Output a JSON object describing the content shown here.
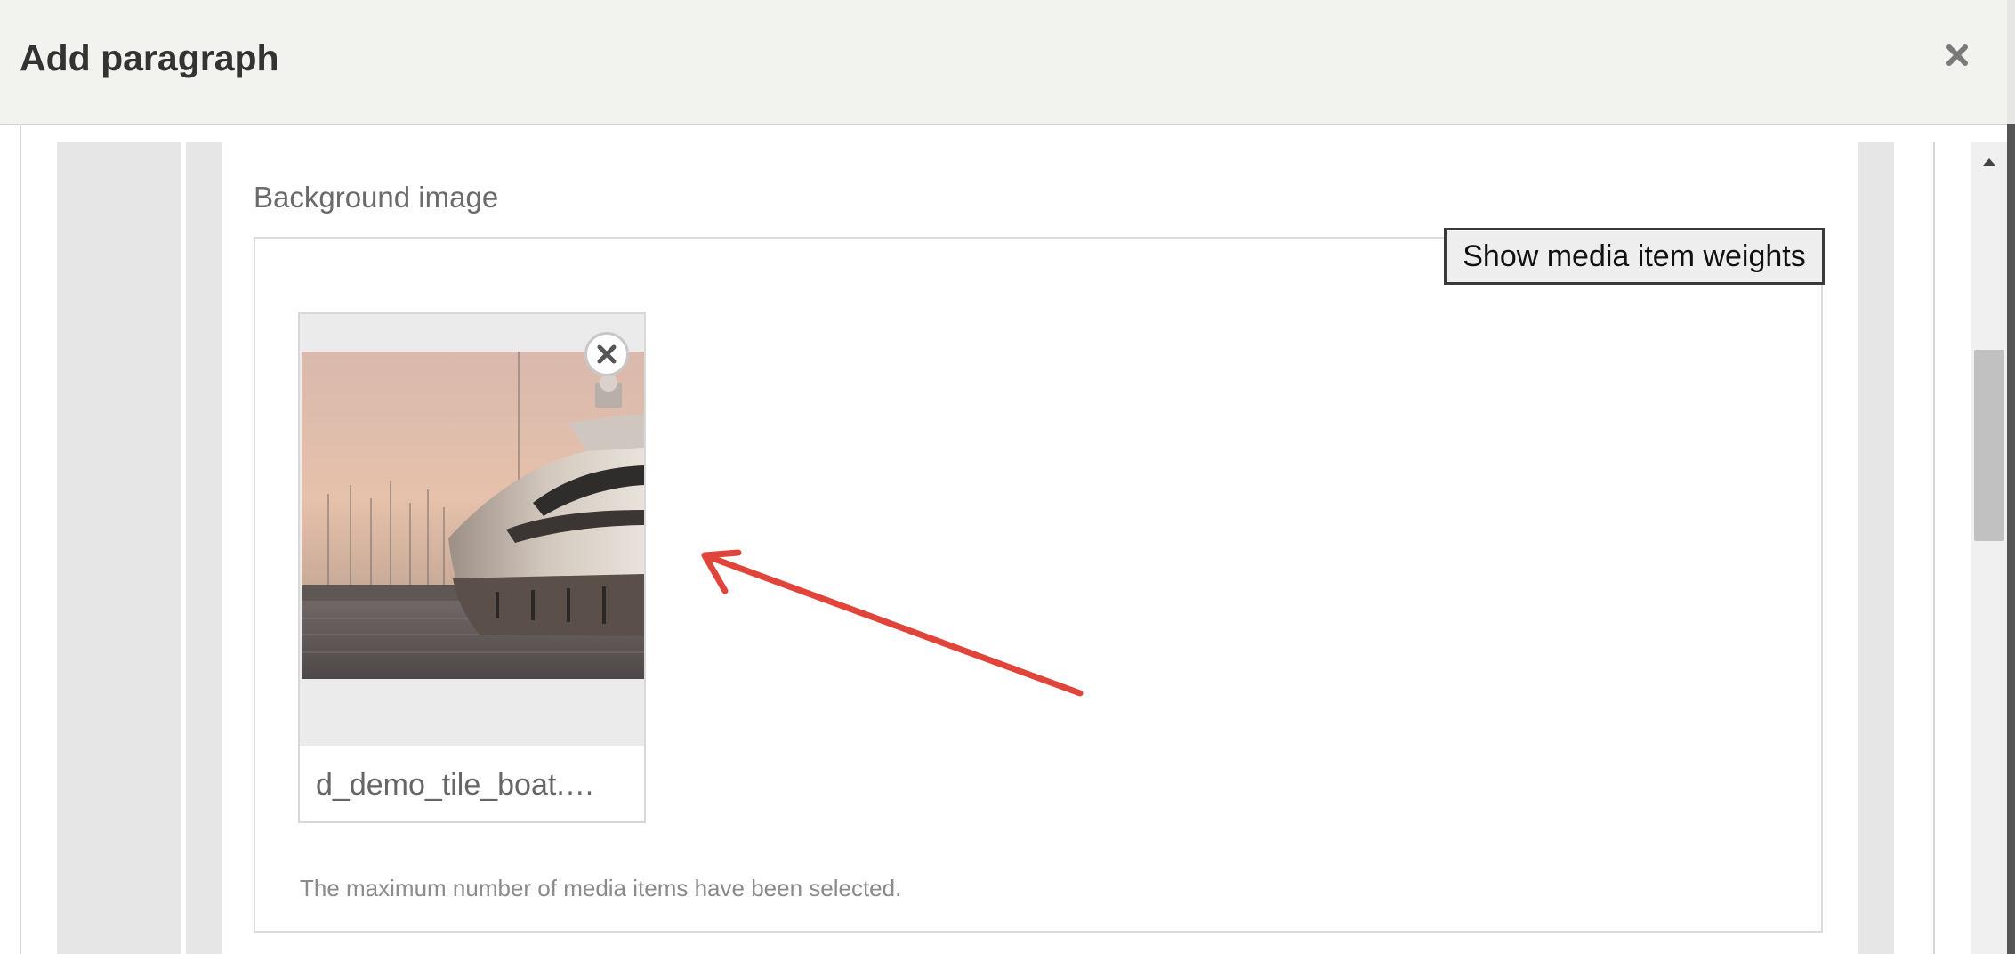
{
  "dialog": {
    "title": "Add paragraph"
  },
  "field": {
    "label": "Background image",
    "show_weights_label": "Show media item weights",
    "media_item": {
      "filename": "d_demo_tile_boat.…",
      "thumbnail_icon": "yacht-photo"
    },
    "description": "The maximum number of media items have been selected."
  },
  "icons": {
    "dialog_close": "close-icon",
    "remove_media": "close-circle-icon",
    "scroll_up": "caret-up-icon",
    "annotation": "arrow-icon"
  },
  "colors": {
    "header_bg": "#f2f2ee",
    "annotation_arrow": "#e0443b",
    "panel_gray": "#e6e6e6"
  }
}
